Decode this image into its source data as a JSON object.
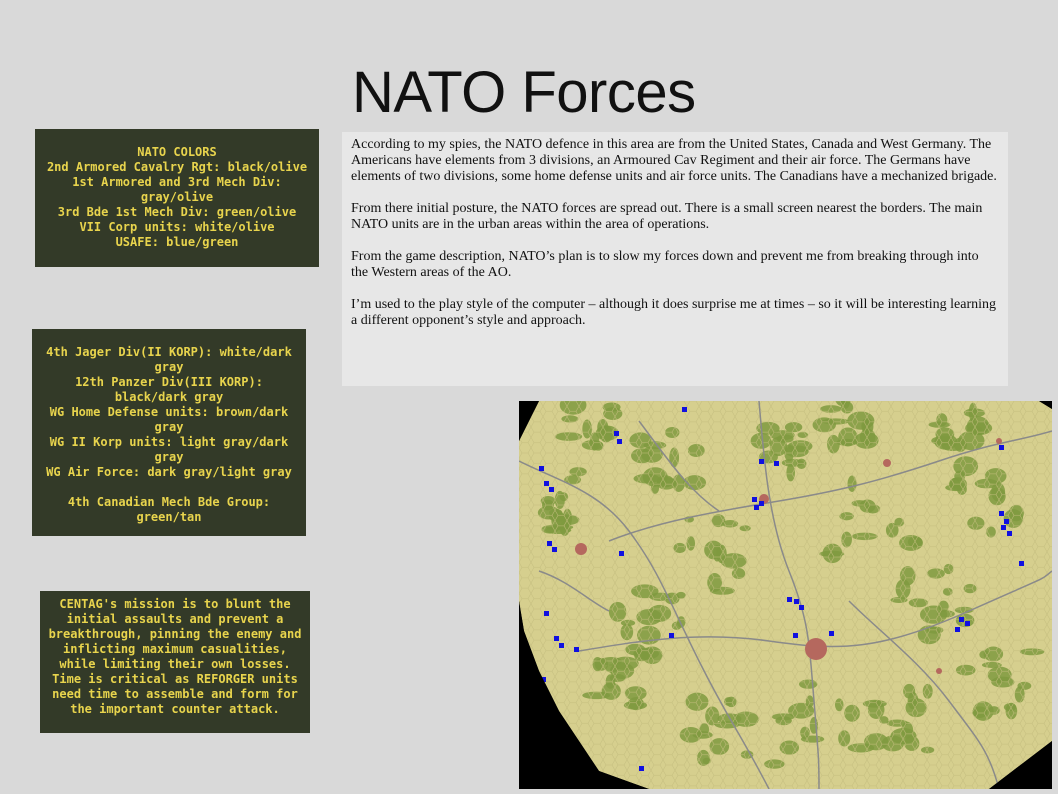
{
  "slide": {
    "title": "NATO Forces"
  },
  "nato_colors": {
    "lines": [
      "NATO COLORS",
      "2nd Armored Cavalry Rgt: black/olive",
      "1st Armored and 3rd Mech Div:",
      "gray/olive",
      "3rd Bde 1st Mech Div: green/olive",
      "VII Corp units: white/olive",
      "USAFE: blue/green"
    ]
  },
  "wg_colors": {
    "lines": [
      "4th Jager Div(II KORP): white/dark",
      "gray",
      "12th Panzer Div(III KORP):",
      "black/dark gray",
      "WG Home Defense units: brown/dark",
      "gray",
      "WG II Korp units: light gray/dark",
      "gray",
      "WG Air Force: dark gray/light gray",
      "",
      "4th Canadian Mech Bde Group:",
      "green/tan"
    ]
  },
  "mission": {
    "lines": [
      "CENTAG's mission is to blunt the",
      "initial assaults and prevent a",
      "breakthrough, pinning the enemy and",
      "inflicting maximum casualities,",
      "while limiting their own losses.",
      "Time is critical as REFORGER units",
      "need time to assemble and form for",
      "the important counter attack."
    ]
  },
  "narrative": {
    "paragraphs": [
      "According to my spies, the NATO defence in this area are from the United States, Canada and West Germany.  The Americans have elements from 3 divisions, an Armoured Cav Regiment and their air force.  The Germans have elements of two divisions, some home defense units and air force units.  The Canadians have a mechanized brigade.",
      "From there initial posture, the NATO forces are spread out.  There is a small screen nearest the borders.  The main NATO units are in the urban areas within the area of operations.",
      "From the game description, NATO’s plan is to slow my forces down and prevent me from breaking through into the Western areas of the AO.",
      "I’m used to the play style of the computer – although it does surprise me at times – so it will be interesting learning a different opponent’s style and approach."
    ]
  },
  "map": {
    "colors": {
      "terrain": "#d6cf8e",
      "forest": "#7f9a3f",
      "road": "#8a8a8a",
      "urban": "#b5685e",
      "nato_unit": "#1010e0",
      "offmap": "#000000"
    },
    "icon": "hex-map-icon"
  }
}
